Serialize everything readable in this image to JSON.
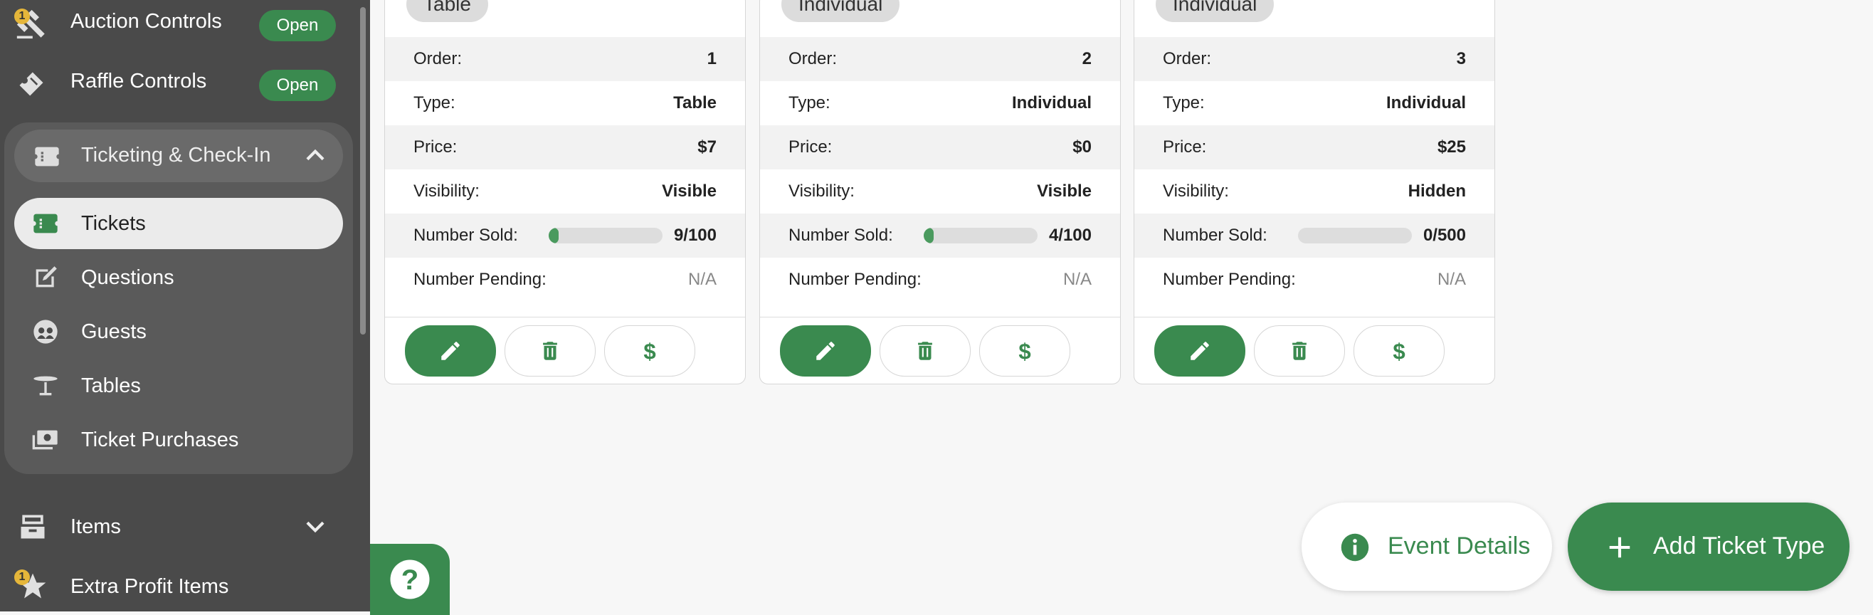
{
  "sidebar": {
    "auction": {
      "label": "Auction Controls",
      "status": "Open",
      "badge": "1"
    },
    "raffle": {
      "label": "Raffle Controls",
      "status": "Open"
    },
    "ticketing": {
      "label": "Ticketing & Check-In",
      "items": [
        {
          "label": "Tickets",
          "icon": "ticket-icon"
        },
        {
          "label": "Questions",
          "icon": "edit-note-icon"
        },
        {
          "label": "Guests",
          "icon": "guests-icon"
        },
        {
          "label": "Tables",
          "icon": "table-icon"
        },
        {
          "label": "Ticket Purchases",
          "icon": "purchase-icon"
        }
      ]
    },
    "items": {
      "label": "Items"
    },
    "extra_profit": {
      "label": "Extra Profit Items",
      "badge": "1"
    }
  },
  "cards": [
    {
      "chip": "Table",
      "order": "1",
      "type": "Table",
      "price": "$7",
      "visibility": "Visible",
      "sold": "9/100",
      "sold_fraction": 0.09,
      "pending": "N/A"
    },
    {
      "chip": "Individual",
      "order": "2",
      "type": "Individual",
      "price": "$0",
      "visibility": "Visible",
      "sold": "4/100",
      "sold_fraction": 0.04,
      "pending": "N/A"
    },
    {
      "chip": "Individual",
      "order": "3",
      "type": "Individual",
      "price": "$25",
      "visibility": "Hidden",
      "sold": "0/500",
      "sold_fraction": 0.0,
      "pending": "N/A"
    }
  ],
  "labels": {
    "order": "Order:",
    "type": "Type:",
    "price": "Price:",
    "visibility": "Visibility:",
    "sold": "Number Sold:",
    "pending": "Number Pending:"
  },
  "actions": {
    "event_details": "Event Details",
    "add_ticket_type": "Add Ticket Type"
  },
  "colors": {
    "accent": "#3a8a4f",
    "sidebar_bg": "#4a4a4a",
    "badge": "#e5b63a"
  }
}
